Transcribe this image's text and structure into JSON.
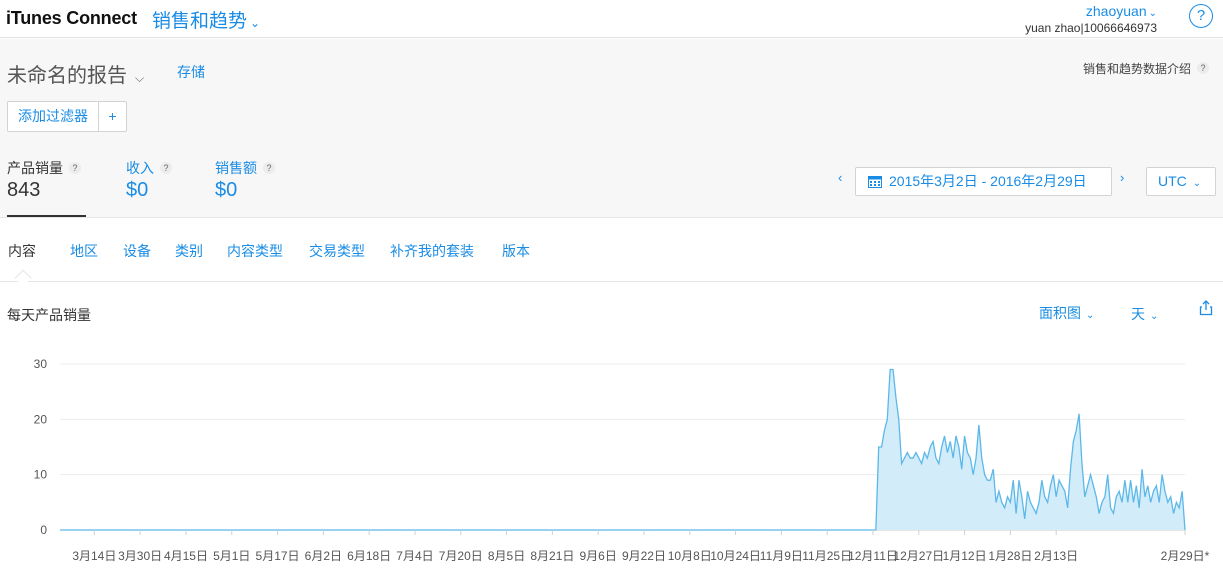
{
  "app": {
    "brand": "iTunes Connect",
    "module": "销售和趋势"
  },
  "user": {
    "name": "zhaoyuan",
    "account": "yuan zhao|10066646973"
  },
  "help_label": "?",
  "report": {
    "title": "未命名的报告",
    "save": "存储",
    "intro": "销售和趋势数据介绍"
  },
  "filter": {
    "add_label": "添加过滤器",
    "plus": "+"
  },
  "metrics": [
    {
      "label": "产品销量",
      "value": "843"
    },
    {
      "label": "收入",
      "value": "$0"
    },
    {
      "label": "销售额",
      "value": "$0"
    }
  ],
  "date_range": {
    "prev": "‹",
    "value": "2015年3月2日 - 2016年2月29日",
    "next": "›"
  },
  "timezone": "UTC",
  "tabs": [
    "内容",
    "地区",
    "设备",
    "类别",
    "内容类型",
    "交易类型",
    "补齐我的套装",
    "版本"
  ],
  "chart": {
    "title": "每天产品销量",
    "type_label": "面积图",
    "granularity_label": "天"
  },
  "chart_data": {
    "type": "area",
    "ylim": [
      0,
      30
    ],
    "yticks": [
      0,
      10,
      20,
      30
    ],
    "xticks": [
      "3月14日",
      "3月30日",
      "4月15日",
      "5月1日",
      "5月17日",
      "6月2日",
      "6月18日",
      "7月4日",
      "7月20日",
      "8月5日",
      "8月21日",
      "9月6日",
      "9月22日",
      "10月8日",
      "10月24日",
      "11月9日",
      "11月25日",
      "12月11日",
      "12月27日",
      "1月12日",
      "1月28日",
      "2月13日",
      "2月29日*"
    ],
    "color": "#5bb8e8",
    "fill": "#d3ecfa",
    "zero_days_before_spike": 286,
    "values": [
      15,
      15,
      18,
      20,
      29,
      29,
      24,
      20,
      12,
      13,
      14,
      13,
      13,
      14,
      13,
      12,
      14,
      13,
      15,
      16,
      13,
      12,
      15,
      17,
      14,
      16,
      13,
      17,
      15,
      11,
      17,
      14,
      13,
      10,
      13,
      19,
      13,
      10,
      9,
      9,
      11,
      5,
      7,
      5,
      4,
      6,
      5,
      9,
      3,
      9,
      6,
      2,
      7,
      5,
      4,
      3,
      5,
      9,
      6,
      5,
      8,
      10,
      6,
      9,
      8,
      7,
      4,
      11,
      16,
      18,
      21,
      12,
      6,
      8,
      10,
      8,
      6,
      3,
      5,
      6,
      10,
      4,
      3,
      6,
      7,
      5,
      9,
      5,
      9,
      5,
      8,
      4,
      11,
      6,
      8,
      5,
      7,
      8,
      5,
      10,
      7,
      5,
      6,
      3,
      5,
      4,
      7,
      0
    ]
  }
}
